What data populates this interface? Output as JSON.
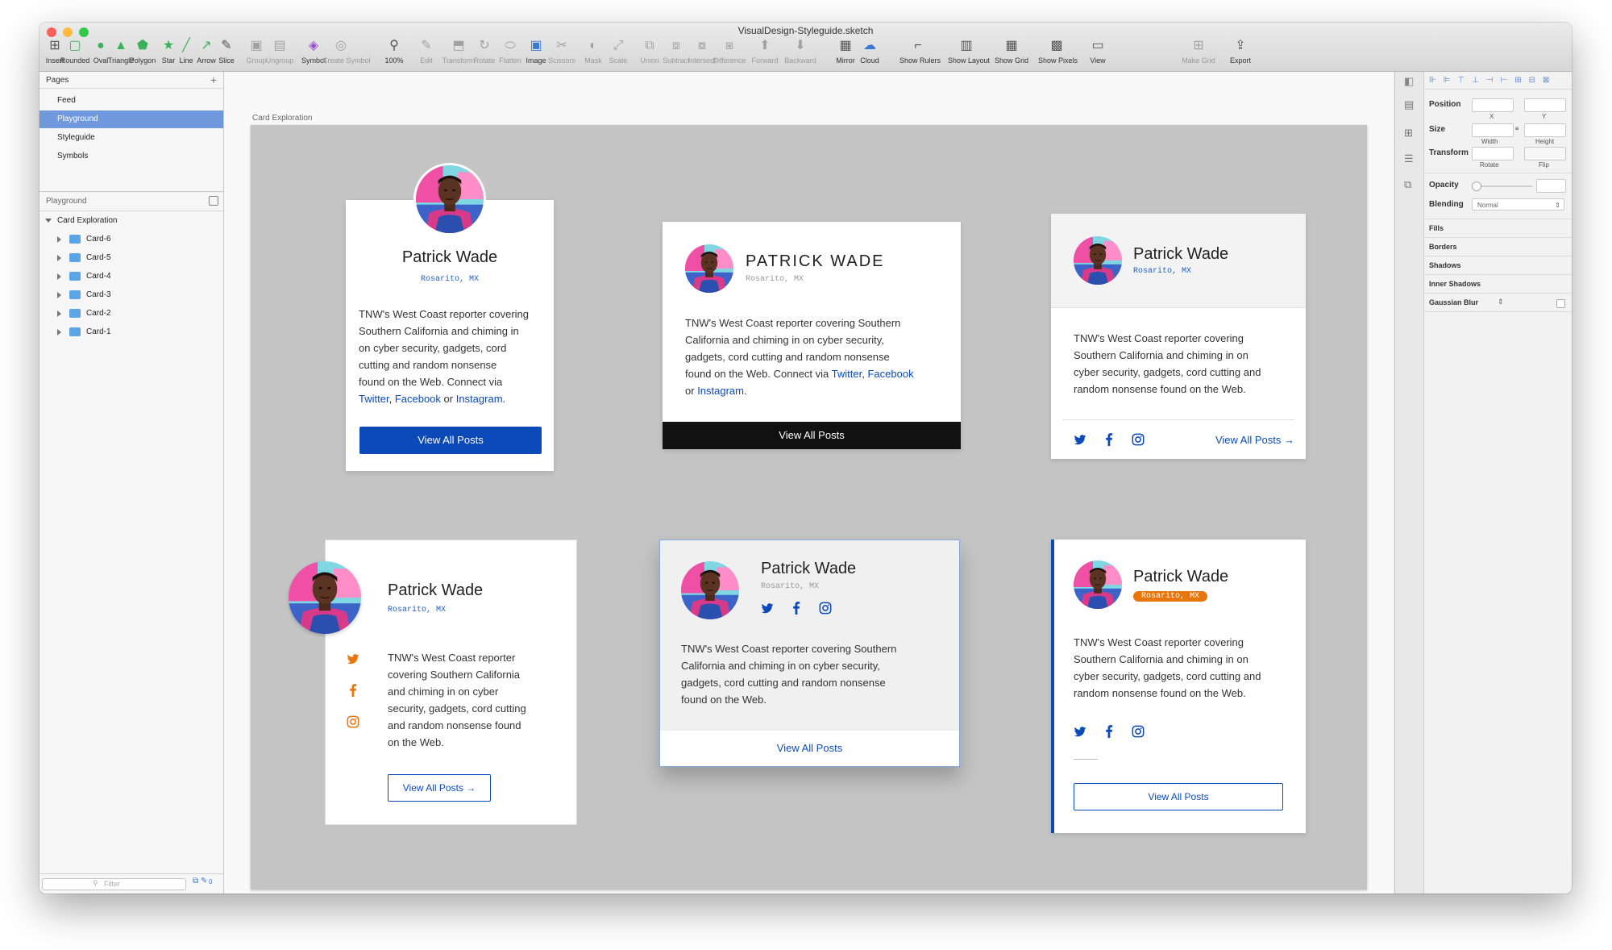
{
  "window": {
    "title": "VisualDesign-Styleguide.sketch",
    "traffic_lights": [
      "#fc605c",
      "#fdbc40",
      "#34c84a"
    ]
  },
  "toolbar": {
    "items": [
      {
        "label": "Insert",
        "icon": "plus-box-icon"
      },
      {
        "label": "Rounded",
        "icon": "rounded-rect-icon"
      },
      {
        "label": "Oval",
        "icon": "oval-icon"
      },
      {
        "label": "Triangle",
        "icon": "triangle-icon"
      },
      {
        "label": "Polygon",
        "icon": "polygon-icon"
      },
      {
        "label": "Star",
        "icon": "star-icon"
      },
      {
        "label": "Line",
        "icon": "line-icon"
      },
      {
        "label": "Arrow",
        "icon": "arrow-icon"
      },
      {
        "label": "Slice",
        "icon": "slice-icon"
      },
      {
        "label": "Group",
        "icon": "group-icon"
      },
      {
        "label": "Ungroup",
        "icon": "ungroup-icon"
      },
      {
        "label": "Symbol",
        "icon": "symbol-icon"
      },
      {
        "label": "Create Symbol",
        "icon": "create-symbol-icon"
      },
      {
        "label": "100%",
        "icon": "zoom-icon"
      },
      {
        "label": "Edit",
        "icon": "edit-icon"
      },
      {
        "label": "Transform",
        "icon": "transform-icon"
      },
      {
        "label": "Rotate",
        "icon": "rotate-icon"
      },
      {
        "label": "Flatten",
        "icon": "flatten-icon"
      },
      {
        "label": "Image",
        "icon": "image-icon"
      },
      {
        "label": "Scissors",
        "icon": "scissors-icon"
      },
      {
        "label": "Mask",
        "icon": "mask-icon"
      },
      {
        "label": "Scale",
        "icon": "scale-icon"
      },
      {
        "label": "Union",
        "icon": "union-icon"
      },
      {
        "label": "Subtract",
        "icon": "subtract-icon"
      },
      {
        "label": "Intersect",
        "icon": "intersect-icon"
      },
      {
        "label": "Difference",
        "icon": "difference-icon"
      },
      {
        "label": "Forward",
        "icon": "forward-icon"
      },
      {
        "label": "Backward",
        "icon": "backward-icon"
      },
      {
        "label": "Mirror",
        "icon": "mirror-icon"
      },
      {
        "label": "Cloud",
        "icon": "cloud-icon"
      },
      {
        "label": "Show Rulers",
        "icon": "rulers-icon"
      },
      {
        "label": "Show Layout",
        "icon": "layout-icon"
      },
      {
        "label": "Show Grid",
        "icon": "grid-icon"
      },
      {
        "label": "Show Pixels",
        "icon": "pixels-icon"
      },
      {
        "label": "View",
        "icon": "view-icon"
      },
      {
        "label": "Make Grid",
        "icon": "make-grid-icon"
      },
      {
        "label": "Export",
        "icon": "export-icon"
      }
    ]
  },
  "pages": {
    "header": "Pages",
    "items": [
      "Feed",
      "Playground",
      "Styleguide",
      "Symbols"
    ],
    "selected": "Playground"
  },
  "layers": {
    "header": "Playground",
    "artboard": "Card Exploration",
    "items": [
      "Card-6",
      "Card-5",
      "Card-4",
      "Card-3",
      "Card-2",
      "Card-1"
    ],
    "filter_placeholder": "Filter",
    "footer_count": "0"
  },
  "canvas": {
    "artboard_label": "Card Exploration"
  },
  "inspector": {
    "position": "Position",
    "x": "X",
    "y": "Y",
    "size": "Size",
    "width": "Width",
    "height": "Height",
    "transform": "Transform",
    "rotate": "Rotate",
    "flip": "Flip",
    "opacity": "Opacity",
    "blending": "Blending",
    "blending_value": "Normal",
    "fills": "Fills",
    "borders": "Borders",
    "shadows": "Shadows",
    "inner_shadows": "Inner Shadows",
    "gaussian_blur": "Gaussian Blur"
  },
  "colors": {
    "brand_blue": "#0b4ab8",
    "black_bar": "#111111",
    "orange": "#e8760c",
    "selection": "#6f99dc"
  },
  "cards": [
    {
      "name": "Patrick Wade",
      "location": "Rosarito, MX",
      "bio_lines": [
        "TNW's West Coast reporter covering",
        "Southern California and chiming in",
        "on cyber security, gadgets, cord",
        "cutting and random nonsense",
        "found on the Web. Connect via"
      ],
      "links": {
        "twitter": "Twitter",
        "facebook": "Facebook",
        "or": "or",
        "instagram": "Instagram"
      },
      "button": "View All Posts"
    },
    {
      "name": "PATRICK WADE",
      "location": "Rosarito, MX",
      "bio_lines": [
        "TNW's West Coast reporter covering Southern",
        "California and chiming in on cyber security,",
        "gadgets, cord cutting and random nonsense",
        "found on the Web. Connect via"
      ],
      "links": {
        "twitter": "Twitter",
        "facebook": "Facebook",
        "or": "or",
        "instagram": "Instagram"
      },
      "button": "View All Posts"
    },
    {
      "name": "Patrick Wade",
      "location": "Rosarito, MX",
      "bio_lines": [
        "TNW's West Coast reporter covering",
        "Southern California and chiming in on",
        "cyber security, gadgets, cord cutting and",
        "random nonsense found on the Web."
      ],
      "button": "View All Posts"
    },
    {
      "name": "Patrick Wade",
      "location": "Rosarito, MX",
      "bio_lines": [
        "TNW's West Coast reporter",
        "covering Southern California",
        "and chiming in on cyber",
        "security, gadgets, cord cutting",
        "and random nonsense found",
        "on the Web."
      ],
      "button": "View All Posts"
    },
    {
      "name": "Patrick Wade",
      "location": "Rosarito, MX",
      "bio_lines": [
        "TNW's West Coast reporter covering Southern",
        "California and chiming in on cyber security,",
        "gadgets, cord cutting and random nonsense",
        "found on the Web."
      ],
      "button": "View All Posts"
    },
    {
      "name": "Patrick Wade",
      "location": "Rosarito, MX",
      "bio_lines": [
        "TNW's West Coast reporter covering",
        "Southern California and chiming in on",
        "cyber security, gadgets, cord cutting and",
        "random nonsense found on the Web."
      ],
      "button": "View All Posts"
    }
  ]
}
